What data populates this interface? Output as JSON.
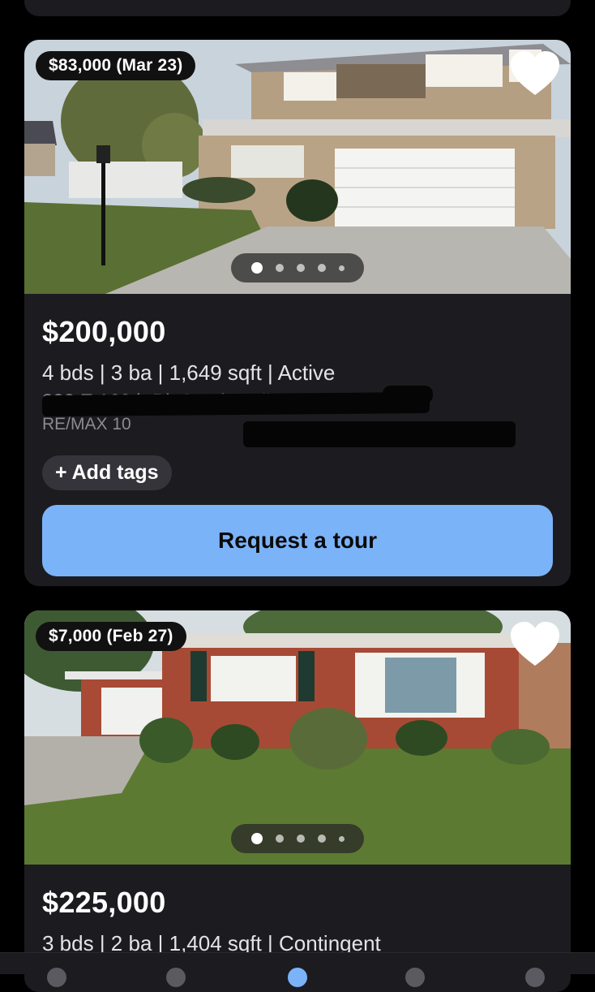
{
  "listings": [
    {
      "price_change": "$83,000 (Mar 23)",
      "price": "$200,000",
      "specs": "4 bds | 3 ba | 1,649 sqft | Active",
      "address": "838 E 169th Pl, South Holland, IL",
      "broker": "RE/MAX 10",
      "add_tags": "+ Add tags",
      "tour_button": "Request a tour",
      "photo_index": 1,
      "photo_count": 5
    },
    {
      "price_change": "$7,000 (Feb 27)",
      "price": "$225,000",
      "specs": "3 bds | 2 ba | 1,404 sqft | Contingent",
      "photo_index": 1,
      "photo_count": 5
    }
  ],
  "icons": {
    "favorite": "heart-icon"
  },
  "colors": {
    "card_bg": "#1c1c20",
    "tour_button": "#7bb3f9",
    "tag_pill": "#34343a"
  }
}
